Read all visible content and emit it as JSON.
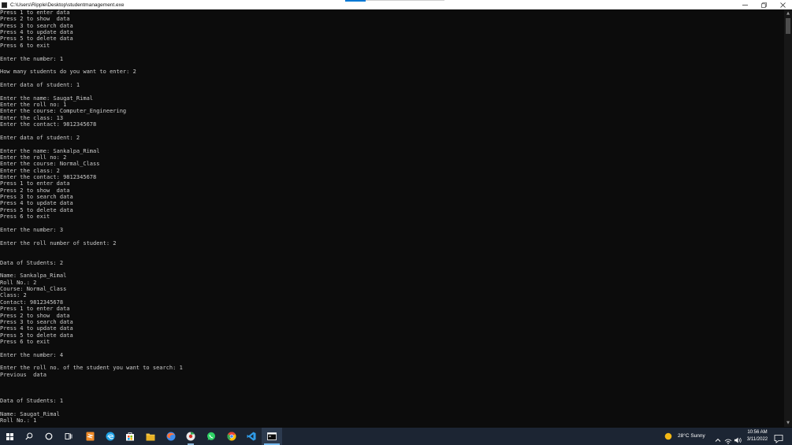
{
  "window": {
    "title": "C:\\Users\\Ripple\\Desktop\\studentmanagement.exe",
    "controls": {
      "minimize": "–",
      "restore": "❐",
      "close": "✕"
    }
  },
  "console": {
    "lines": [
      "Press 1 to enter data",
      "Press 2 to show  data",
      "Press 3 to search data",
      "Press 4 to update data",
      "Press 5 to delete data",
      "Press 6 to exit",
      "",
      "Enter the number: 1",
      "",
      "How many students do you want to enter: 2",
      "",
      "Enter data of student: 1",
      "",
      "Enter the name: Saugat_Rimal",
      "Enter the roll no: 1",
      "Enter the course: Computer_Engineering",
      "Enter the class: 13",
      "Enter the contact: 9812345678",
      "",
      "Enter data of student: 2",
      "",
      "Enter the name: Sankalpa_Rimal",
      "Enter the roll no: 2",
      "Enter the course: Normal_Class",
      "Enter the class: 2",
      "Enter the contact: 9812345678",
      "Press 1 to enter data",
      "Press 2 to show  data",
      "Press 3 to search data",
      "Press 4 to update data",
      "Press 5 to delete data",
      "Press 6 to exit",
      "",
      "Enter the number: 3",
      "",
      "Enter the roll number of student: 2",
      "",
      "",
      "Data of Students: 2",
      "",
      "Name: Sankalpa_Rimal",
      "Roll No.: 2",
      "Course: Normal_Class",
      "Class: 2",
      "Contact: 9812345678",
      "Press 1 to enter data",
      "Press 2 to show  data",
      "Press 3 to search data",
      "Press 4 to update data",
      "Press 5 to delete data",
      "Press 6 to exit",
      "",
      "Enter the number: 4",
      "",
      "Enter the roll no. of the student you want to search: 1",
      "Previous  data",
      "",
      "",
      "",
      "Data of Students: 1",
      "",
      "Name: Saugat_Rimal",
      "Roll No.: 1"
    ]
  },
  "scrollbar": {
    "up": "▲",
    "down": "▼"
  },
  "taskbar": {
    "apps": [
      {
        "name": "windows-start-icon",
        "color": "#ffffff"
      },
      {
        "name": "search-icon",
        "color": "#ffffff"
      },
      {
        "name": "cortana-icon",
        "color": "#ffffff"
      },
      {
        "name": "task-view-icon",
        "color": "#ffffff"
      },
      {
        "name": "sublime-text-icon",
        "color": "#f28c28"
      },
      {
        "name": "edge-icon",
        "color": "#1fa3e8"
      },
      {
        "name": "store-icon",
        "color": "#ffffff"
      },
      {
        "name": "file-explorer-icon",
        "color": "#f4c542"
      },
      {
        "name": "firefox-icon",
        "color": "#3d8ef0"
      },
      {
        "name": "chrome-profile-icon",
        "color": "#e9e9e9"
      },
      {
        "name": "whatsapp-icon",
        "color": "#2fd366"
      },
      {
        "name": "chrome-icon",
        "color": "#e94335"
      },
      {
        "name": "vscode-icon",
        "color": "#2f9ce8"
      },
      {
        "name": "console-app-icon",
        "color": "#ffffff"
      }
    ],
    "weather": {
      "temp": "28°C  Sunny",
      "icon": "sun-icon",
      "icon_color": "#f3b815"
    },
    "tray": {
      "chevron": "^",
      "network": "network-icon",
      "volume": "volume-icon"
    },
    "clock": {
      "time": "10:56 AM",
      "date": "3/11/2022"
    }
  }
}
